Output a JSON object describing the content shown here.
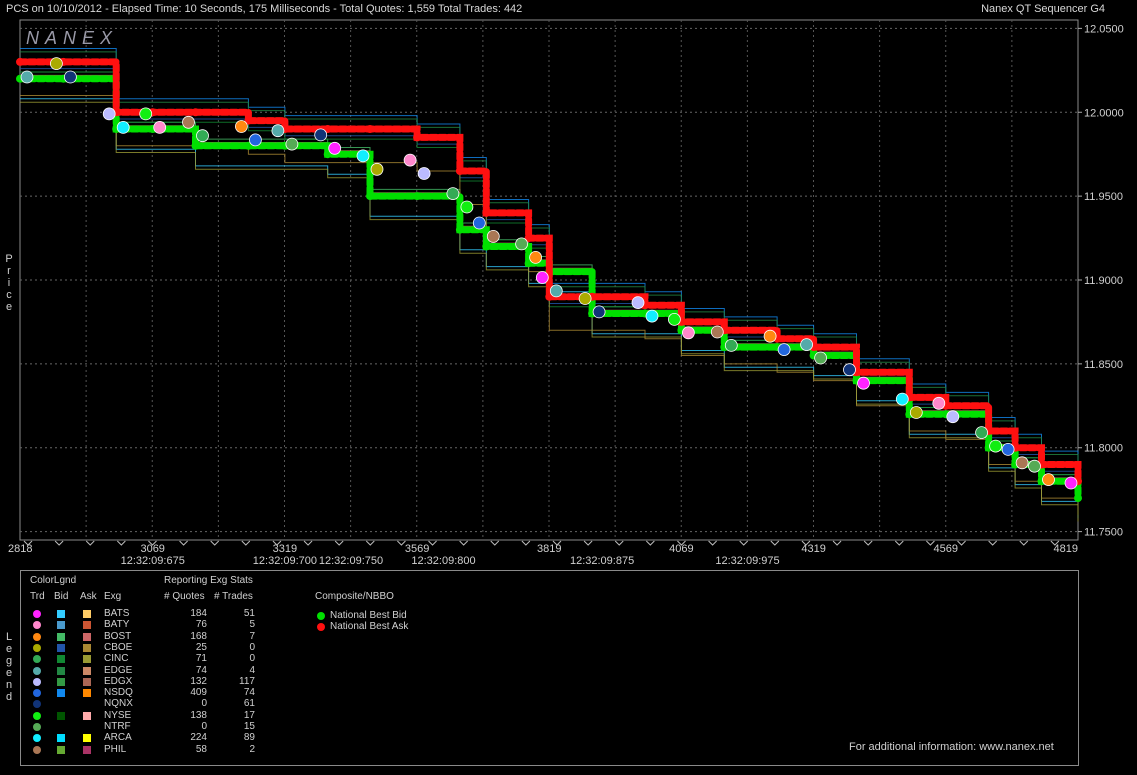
{
  "header": {
    "left_title": "PCS on 10/10/2012  -  Elapsed Time: 10 Seconds, 175 Milliseconds  -  Total Quotes: 1,559  Total Trades: 442",
    "right_title": "Nanex QT Sequencer G4"
  },
  "watermark": "NANEX",
  "side_labels": {
    "price": [
      "P",
      "r",
      "i",
      "c",
      "e"
    ],
    "legend": [
      "L",
      "e",
      "g",
      "e",
      "n",
      "d"
    ]
  },
  "chart_data": {
    "type": "line",
    "xlim": [
      2818,
      4819
    ],
    "ylim": [
      11.745,
      12.055
    ],
    "y_ticks": [
      {
        "value": 12.05,
        "label": "12.0500"
      },
      {
        "value": 12.0,
        "label": "12.0000"
      },
      {
        "value": 11.95,
        "label": "11.9500"
      },
      {
        "value": 11.9,
        "label": "11.9000"
      },
      {
        "value": 11.85,
        "label": "11.8500"
      },
      {
        "value": 11.8,
        "label": "11.8000"
      },
      {
        "value": 11.75,
        "label": "11.7500"
      }
    ],
    "x_ticks": [
      {
        "value": 2818,
        "label": "2818"
      },
      {
        "value": 3069,
        "label": "3069"
      },
      {
        "value": 3319,
        "label": "3319"
      },
      {
        "value": 3569,
        "label": "3569"
      },
      {
        "value": 3819,
        "label": "3819"
      },
      {
        "value": 4069,
        "label": "4069"
      },
      {
        "value": 4319,
        "label": "4319"
      },
      {
        "value": 4569,
        "label": "4569"
      },
      {
        "value": 4819,
        "label": "4819"
      }
    ],
    "time_labels": [
      {
        "x": 3069,
        "label": "12:32:09:675"
      },
      {
        "x": 3319,
        "label": "12:32:09:700"
      },
      {
        "x": 3444,
        "label": "12:32:09:750"
      },
      {
        "x": 3619,
        "label": "12:32:09:800"
      },
      {
        "x": 3919,
        "label": "12:32:09:875"
      },
      {
        "x": 4194,
        "label": "12:32:09:975"
      }
    ],
    "grid": true,
    "series": [
      {
        "name": "National Best Bid",
        "color": "#00e000",
        "x": [
          2818,
          2900,
          3000,
          3069,
          3150,
          3250,
          3319,
          3400,
          3480,
          3569,
          3650,
          3700,
          3780,
          3819,
          3900,
          4000,
          4069,
          4150,
          4250,
          4319,
          4400,
          4500,
          4569,
          4650,
          4700,
          4750,
          4819
        ],
        "y": [
          12.02,
          12.02,
          11.99,
          11.99,
          11.98,
          11.98,
          11.98,
          11.975,
          11.95,
          11.95,
          11.93,
          11.92,
          11.91,
          11.905,
          11.88,
          11.88,
          11.87,
          11.86,
          11.86,
          11.855,
          11.84,
          11.82,
          11.82,
          11.8,
          11.79,
          11.78,
          11.77
        ]
      },
      {
        "name": "National Best Ask",
        "color": "#ff1010",
        "x": [
          2818,
          2900,
          3000,
          3069,
          3150,
          3250,
          3319,
          3400,
          3480,
          3569,
          3650,
          3700,
          3780,
          3819,
          3900,
          4000,
          4069,
          4150,
          4250,
          4319,
          4400,
          4500,
          4569,
          4650,
          4700,
          4750,
          4819
        ],
        "y": [
          12.03,
          12.03,
          12.0,
          12.0,
          12.0,
          11.995,
          11.99,
          11.99,
          11.99,
          11.985,
          11.965,
          11.94,
          11.925,
          11.89,
          11.89,
          11.885,
          11.875,
          11.87,
          11.865,
          11.86,
          11.845,
          11.83,
          11.825,
          11.81,
          11.8,
          11.79,
          11.78
        ]
      }
    ]
  },
  "legend": {
    "col_headers": {
      "trd": "Trd",
      "bid": "Bid",
      "ask": "Ask",
      "exg": "Exg"
    },
    "color_legend_title": "ColorLgnd",
    "stats_title": "Reporting Exg Stats",
    "stats_headers": {
      "quotes": "# Quotes",
      "trades": "# Trades"
    },
    "composite_title": "Composite/NBBO",
    "composite_items": [
      {
        "label": "National Best Bid",
        "color": "#00e000"
      },
      {
        "label": "National Best Ask",
        "color": "#ff1010"
      }
    ],
    "footer": "For additional information: www.nanex.net",
    "exchanges": [
      {
        "name": "BATS",
        "trd": "#ff22ff",
        "bid": "#33ccff",
        "ask": "#ffcc66",
        "quotes": "184",
        "trades": "51"
      },
      {
        "name": "BATY",
        "trd": "#ff88cc",
        "bid": "#4a9acd",
        "ask": "#cc5533",
        "quotes": "76",
        "trades": "5"
      },
      {
        "name": "BOST",
        "trd": "#ff8811",
        "bid": "#44bb66",
        "ask": "#cc6666",
        "quotes": "168",
        "trades": "7"
      },
      {
        "name": "CBOE",
        "trd": "#aaaa00",
        "bid": "#2255aa",
        "ask": "#aa8833",
        "quotes": "25",
        "trades": "0"
      },
      {
        "name": "CINC",
        "trd": "#33aa55",
        "bid": "#118833",
        "ask": "#999933",
        "quotes": "71",
        "trades": "0"
      },
      {
        "name": "EDGE",
        "trd": "#55aaaa",
        "bid": "#228844",
        "ask": "#cc8866",
        "quotes": "74",
        "trades": "4"
      },
      {
        "name": "EDGX",
        "trd": "#bbbbff",
        "bid": "#339944",
        "ask": "#aa6655",
        "quotes": "132",
        "trades": "117"
      },
      {
        "name": "NSDQ",
        "trd": "#2266dd",
        "bid": "#1188ee",
        "ask": "#ff8800",
        "quotes": "409",
        "trades": "74"
      },
      {
        "name": "NQNX",
        "trd": "#113377",
        "bid": "",
        "ask": "",
        "quotes": "0",
        "trades": "61"
      },
      {
        "name": "NYSE",
        "trd": "#11ee11",
        "bid": "#005500",
        "ask": "#ffaaaa",
        "quotes": "138",
        "trades": "17"
      },
      {
        "name": "NTRF",
        "trd": "#55aa55",
        "bid": "",
        "ask": "",
        "quotes": "0",
        "trades": "15"
      },
      {
        "name": "ARCA",
        "trd": "#11eeff",
        "bid": "#00ddff",
        "ask": "#ffff00",
        "quotes": "224",
        "trades": "89"
      },
      {
        "name": "PHIL",
        "trd": "#aa7755",
        "bid": "#66aa33",
        "ask": "#aa3366",
        "quotes": "58",
        "trades": "2"
      }
    ]
  }
}
